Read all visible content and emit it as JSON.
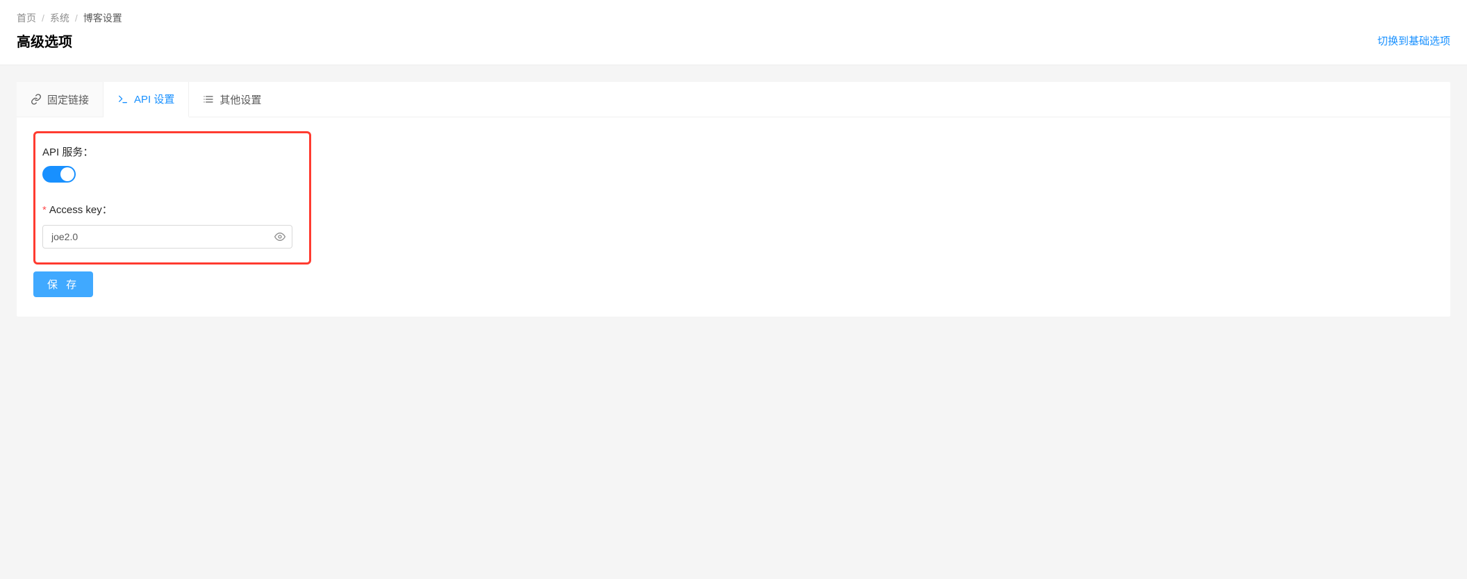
{
  "breadcrumb": {
    "home": "首页",
    "system": "系统",
    "current": "博客设置"
  },
  "header": {
    "title": "高级选项",
    "switch_link": "切换到基础选项"
  },
  "tabs": {
    "permalink": "固定链接",
    "api": "API 设置",
    "other": "其他设置"
  },
  "form": {
    "api_service_label": "API 服务：",
    "api_service_on": true,
    "access_key_label": "Access key：",
    "access_key_value": "joe2.0",
    "save_label": "保 存"
  }
}
